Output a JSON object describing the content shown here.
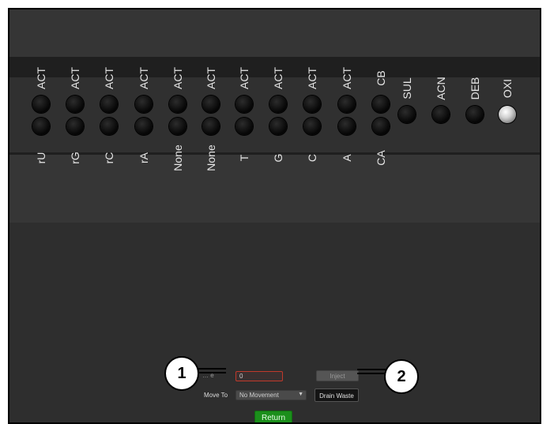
{
  "valves": [
    {
      "top": "ACT",
      "bottom": "rU",
      "state": "off"
    },
    {
      "top": "ACT",
      "bottom": "rG",
      "state": "off"
    },
    {
      "top": "ACT",
      "bottom": "rC",
      "state": "off"
    },
    {
      "top": "ACT",
      "bottom": "rA",
      "state": "off"
    },
    {
      "top": "ACT",
      "bottom": "None",
      "state": "off"
    },
    {
      "top": "ACT",
      "bottom": "None",
      "state": "off"
    },
    {
      "top": "ACT",
      "bottom": "T",
      "state": "off"
    },
    {
      "top": "ACT",
      "bottom": "G",
      "state": "off"
    },
    {
      "top": "ACT",
      "bottom": "C",
      "state": "off"
    },
    {
      "top": "ACT",
      "bottom": "A",
      "state": "off"
    },
    {
      "top": "CB",
      "bottom": "CA",
      "state": "off"
    }
  ],
  "reagents": [
    {
      "label": "SUL",
      "state": "off"
    },
    {
      "label": "ACN",
      "state": "off"
    },
    {
      "label": "DEB",
      "state": "off"
    },
    {
      "label": "OXI",
      "state": "on"
    }
  ],
  "controls": {
    "volume_value": "0",
    "inject_label": "Inject",
    "move_to_label": "Move To",
    "move_to_value": "No Movement",
    "drain_label": "Drain Waste",
    "return_label": "Return"
  },
  "callouts": {
    "one": "1",
    "two": "2"
  }
}
